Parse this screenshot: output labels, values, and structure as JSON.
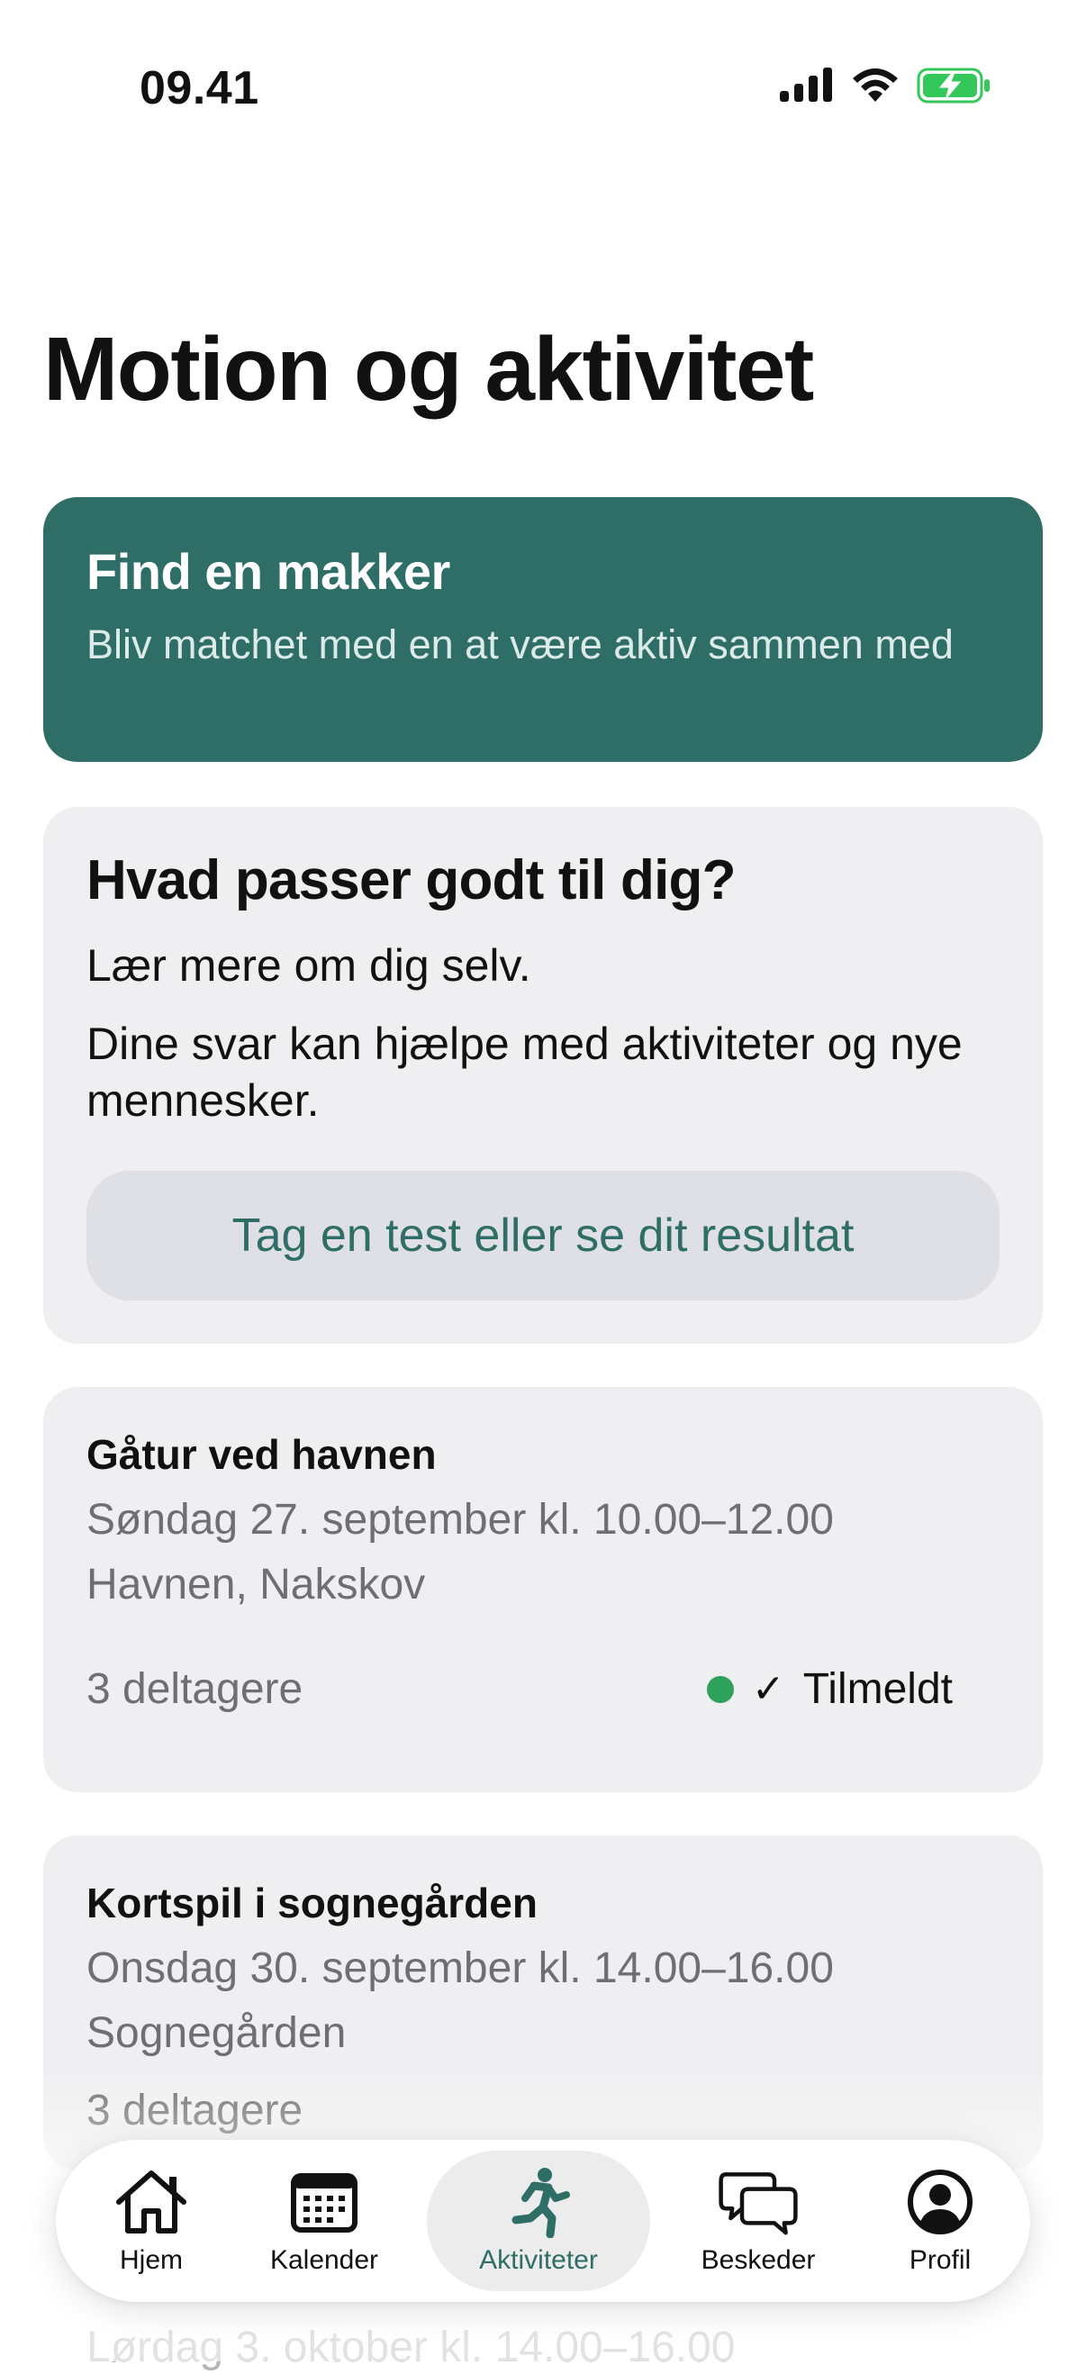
{
  "status_bar": {
    "time": "09.41",
    "icons": [
      "cellular-signal-icon",
      "wifi-icon",
      "battery-charging-icon"
    ]
  },
  "page": {
    "title": "Motion og aktivitet"
  },
  "promo_card": {
    "title": "Find en makker",
    "subtitle": "Bliv matchet med en at være aktiv sammen med",
    "background": "#2e6e66"
  },
  "quiz_card": {
    "title": "Hvad passer godt til dig?",
    "line1": "Lær mere om dig selv.",
    "line2": "Dine svar kan hjælpe med aktiviteter og nye mennesker.",
    "button_label": "Tag en test eller se dit resultat"
  },
  "events": [
    {
      "title": "Gåtur ved havnen",
      "date": "Søndag 27. september kl. 10.00–12.00",
      "location": "Havnen, Nakskov",
      "participants": "3 deltagere",
      "status": "Tilmeldt",
      "status_check": "✓",
      "status_color": "#2ea05a"
    },
    {
      "title": "Kortspil i sognegården",
      "date": "Onsdag 30. september kl. 14.00–16.00",
      "location": "Sognegården",
      "participants": "3 deltagere"
    },
    {
      "date": "Lørdag 3. oktober kl. 14.00–16.00"
    }
  ],
  "tab_bar": {
    "accent": "#2e6e66",
    "tabs": [
      {
        "label": "Hjem",
        "icon": "home-icon",
        "active": false
      },
      {
        "label": "Kalender",
        "icon": "calendar-icon",
        "active": false
      },
      {
        "label": "Aktiviteter",
        "icon": "running-person-icon",
        "active": true
      },
      {
        "label": "Beskeder",
        "icon": "chat-bubbles-icon",
        "active": false
      },
      {
        "label": "Profil",
        "icon": "profile-icon",
        "active": false
      }
    ]
  }
}
